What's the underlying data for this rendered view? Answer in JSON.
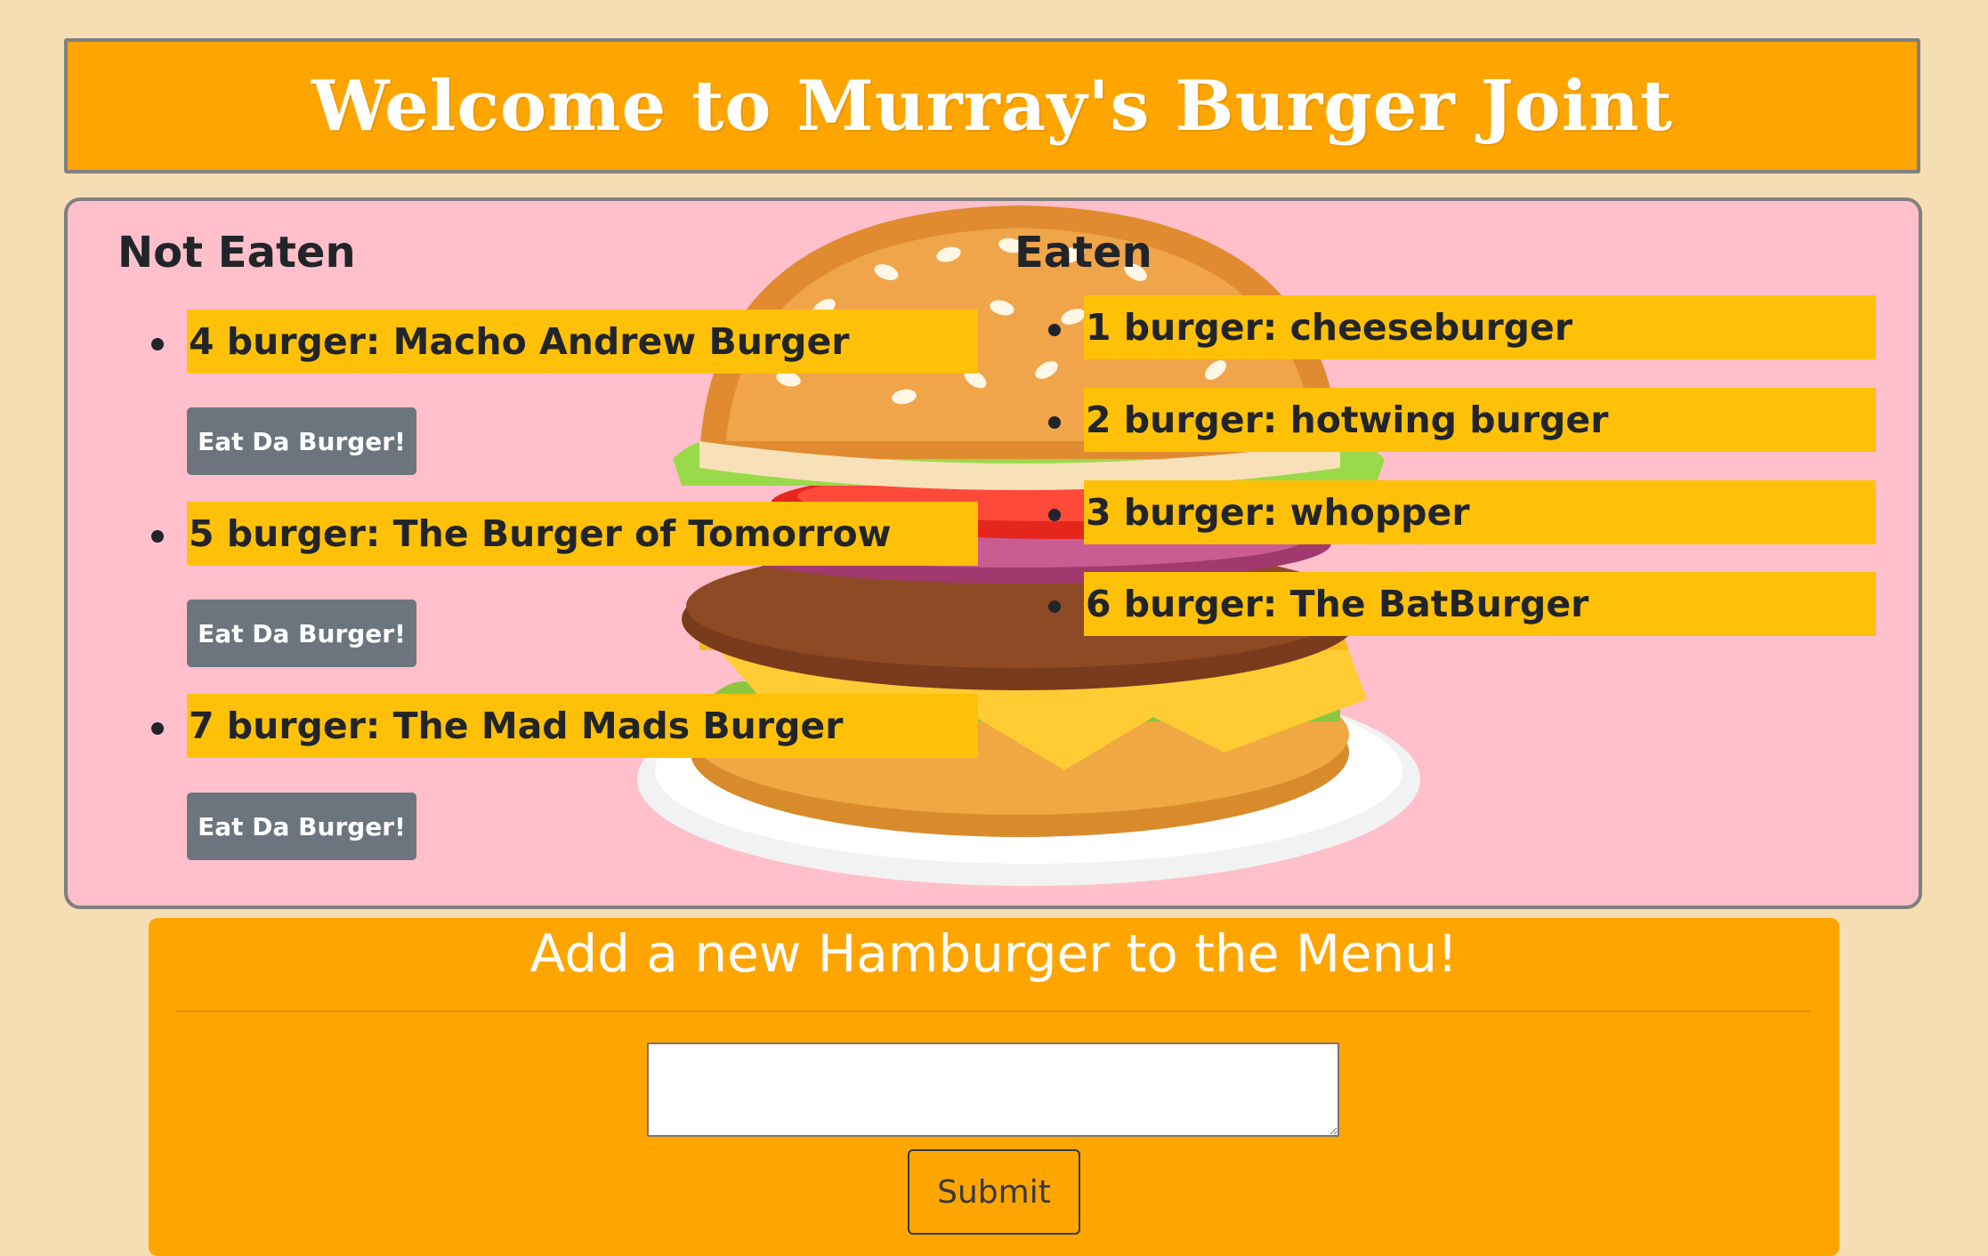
{
  "header": {
    "title": "Welcome to Murray's Burger Joint"
  },
  "not_eaten": {
    "title": "Not Eaten",
    "items": [
      {
        "label": "4 burger: Macho Andrew Burger",
        "button": "Eat Da Burger!"
      },
      {
        "label": "5 burger: The Burger of Tomorrow",
        "button": "Eat Da Burger!"
      },
      {
        "label": "7 burger: The Mad Mads Burger",
        "button": "Eat Da Burger!"
      }
    ]
  },
  "eaten": {
    "title": "Eaten",
    "items": [
      {
        "label": "1 burger: cheeseburger"
      },
      {
        "label": "2 burger: hotwing burger"
      },
      {
        "label": "3 burger: whopper"
      },
      {
        "label": "6 burger: The BatBurger"
      }
    ]
  },
  "form": {
    "title": "Add a new Hamburger to the Menu!",
    "input_value": "",
    "submit_label": "Submit"
  },
  "colors": {
    "page_bg": "#f5deb3",
    "header_bg": "#ffa500",
    "menu_bg": "#ffc0cb",
    "item_bar": "#ffc107",
    "eat_button": "#6c757d"
  },
  "icons": {
    "background_image": "hamburger-illustration"
  }
}
